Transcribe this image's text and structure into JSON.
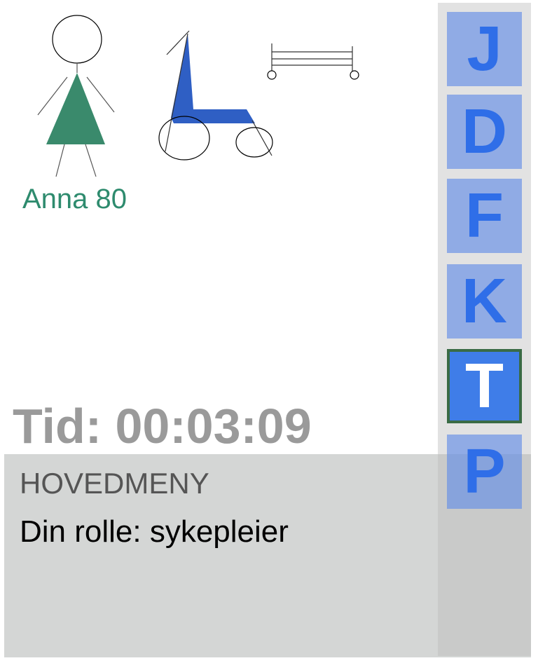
{
  "patient": {
    "name_label": "Anna 80"
  },
  "timer": {
    "text": "Tid: 00:03:09"
  },
  "menu": {
    "title": "HOVEDMENY",
    "role_text": "Din rolle: sykepleier"
  },
  "sidebar": {
    "buttons": [
      {
        "letter": "J",
        "active": false
      },
      {
        "letter": "D",
        "active": false
      },
      {
        "letter": "F",
        "active": false
      },
      {
        "letter": "K",
        "active": false
      },
      {
        "letter": "T",
        "active": true
      },
      {
        "letter": "P",
        "active": false
      }
    ]
  },
  "colors": {
    "patient": "#2e8b6e",
    "wheelchair": "#2f5fc4",
    "button_active_border": "#3a6b45",
    "button_letter": "#2f6ee8"
  },
  "icons": [
    "patient-figure-icon",
    "wheelchair-icon",
    "bed-icon"
  ]
}
